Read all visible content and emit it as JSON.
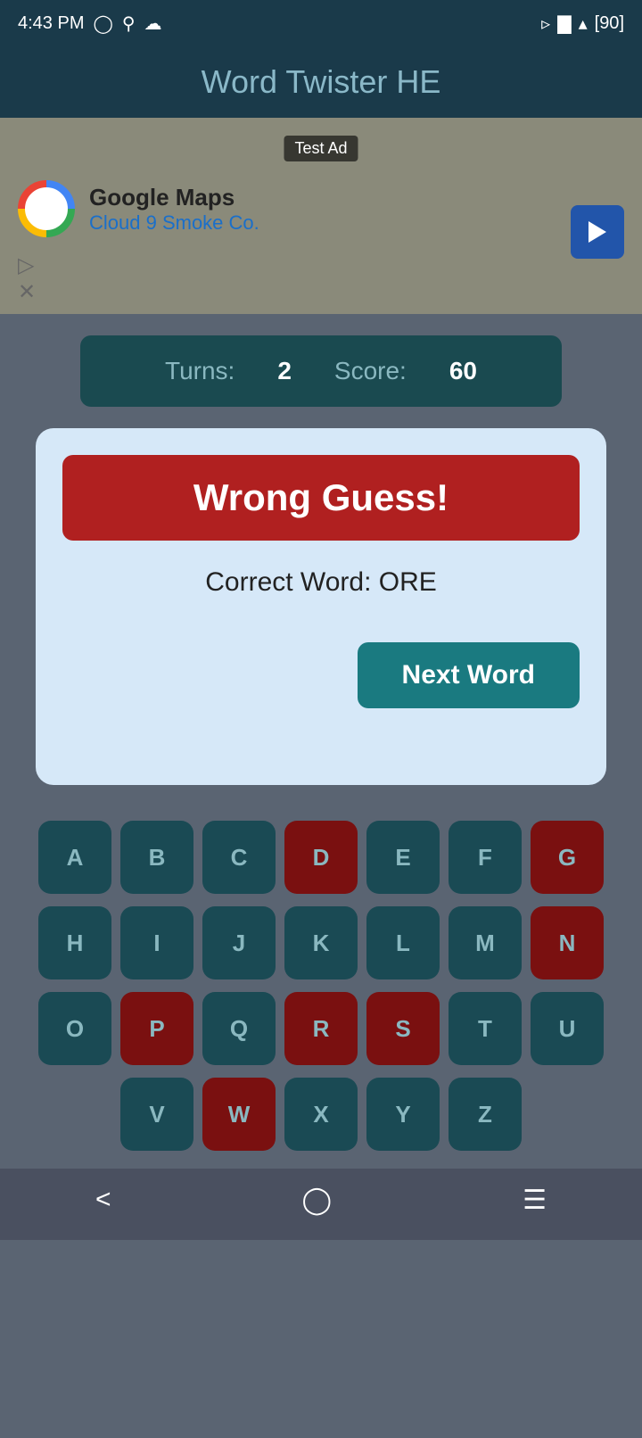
{
  "statusBar": {
    "time": "4:43 PM",
    "battery": "90"
  },
  "header": {
    "title": "Word Twister HE"
  },
  "ad": {
    "label": "Test Ad",
    "company": "Google Maps",
    "subtitle": "Cloud 9 Smoke Co.",
    "playIcon": "▷",
    "closeIcon": "✕"
  },
  "score": {
    "turnsLabel": "Turns:",
    "turnsValue": "2",
    "scoreLabel": "Score:",
    "scoreValue": "60"
  },
  "dialog": {
    "wrongGuessText": "Wrong Guess!",
    "correctWordLabel": "Correct Word: ORE",
    "nextWordButton": "Next Word"
  },
  "keyboard": {
    "rows": [
      [
        {
          "letter": "A",
          "used": false
        },
        {
          "letter": "B",
          "used": false
        },
        {
          "letter": "C",
          "used": false
        },
        {
          "letter": "D",
          "used": true
        },
        {
          "letter": "E",
          "used": false
        },
        {
          "letter": "F",
          "used": false
        },
        {
          "letter": "G",
          "used": true
        }
      ],
      [
        {
          "letter": "H",
          "used": false
        },
        {
          "letter": "I",
          "used": false
        },
        {
          "letter": "J",
          "used": false
        },
        {
          "letter": "K",
          "used": false
        },
        {
          "letter": "L",
          "used": false
        },
        {
          "letter": "M",
          "used": false
        },
        {
          "letter": "N",
          "used": true
        }
      ],
      [
        {
          "letter": "O",
          "used": false
        },
        {
          "letter": "P",
          "used": true
        },
        {
          "letter": "Q",
          "used": false
        },
        {
          "letter": "R",
          "used": true
        },
        {
          "letter": "S",
          "used": true
        },
        {
          "letter": "T",
          "used": false
        },
        {
          "letter": "U",
          "used": false
        }
      ],
      [
        {
          "letter": "V",
          "used": false
        },
        {
          "letter": "W",
          "used": true
        },
        {
          "letter": "X",
          "used": false
        },
        {
          "letter": "Y",
          "used": false
        },
        {
          "letter": "Z",
          "used": false
        }
      ]
    ]
  },
  "bottomNav": {
    "back": "<",
    "home": "○",
    "menu": "≡"
  }
}
